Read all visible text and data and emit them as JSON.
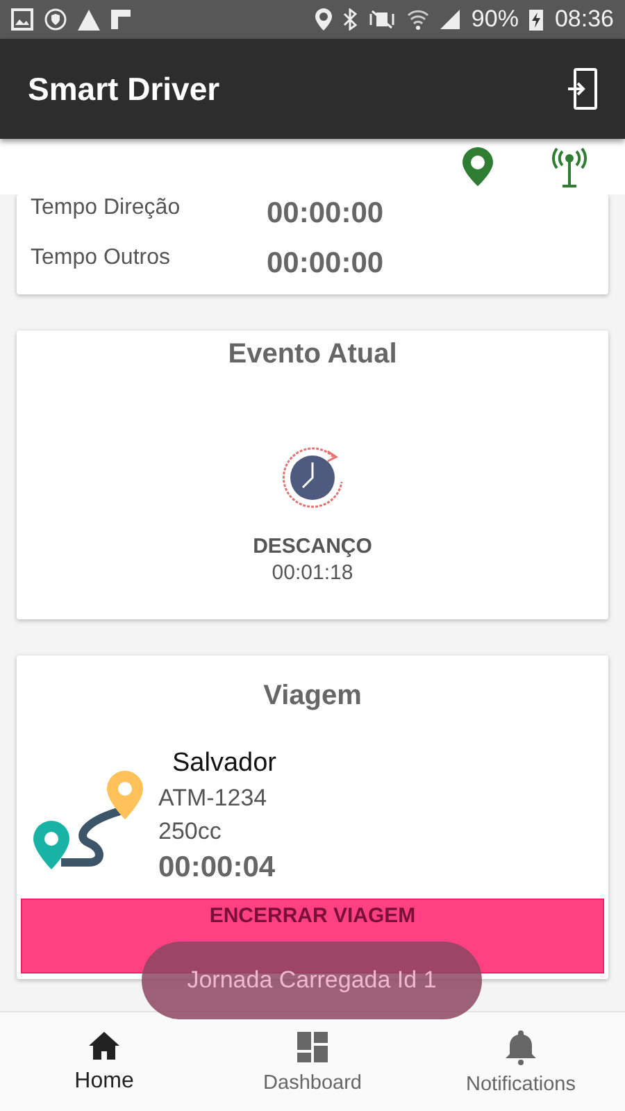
{
  "status_bar": {
    "battery": "90%",
    "time": "08:36"
  },
  "app_bar": {
    "title": "Smart Driver"
  },
  "indicators": [
    {
      "kind": "gps",
      "on": true
    },
    {
      "kind": "antenna",
      "on": true
    }
  ],
  "times": [
    {
      "label": "Tempo Direção",
      "value": "00:00:00"
    },
    {
      "label": "Tempo Outros",
      "value": "00:00:00"
    }
  ],
  "current_event": {
    "title": "Evento Atual",
    "name": "DESCANÇO",
    "time": "00:01:18"
  },
  "trip": {
    "title": "Viagem",
    "city": "Salvador",
    "plate": "ATM-1234",
    "engine": "250cc",
    "elapsed": "00:00:04",
    "button": "ENCERRAR VIAGEM"
  },
  "toast": "Jornada Carregada Id 1",
  "nav": [
    {
      "label": "Home",
      "kind": "home",
      "selected": true
    },
    {
      "label": "Dashboard",
      "kind": "dashboard",
      "selected": false
    },
    {
      "label": "Notifications",
      "kind": "notifications",
      "selected": false
    }
  ]
}
